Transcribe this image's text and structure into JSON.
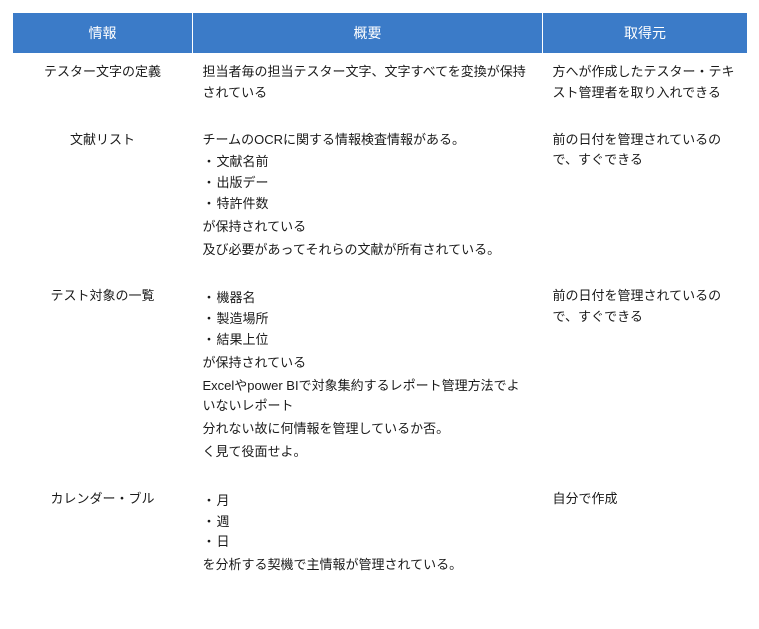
{
  "headers": {
    "col1": "情報",
    "col2": "概要",
    "col3": "取得元"
  },
  "rows": [
    {
      "info": "テスター文字の定義",
      "summary_lines": [
        "担当者毎の担当テスター文字、文字すべてを変換が保持されている"
      ],
      "source": "方へが作成したテスター・テキスト管理者を取り入れできる"
    },
    {
      "info": "文献リスト",
      "summary_lines": [
        "チームのOCRに関する情報検査情報がある。"
      ],
      "summary_bullets": [
        "文献名前",
        "出版デー",
        "特許件数"
      ],
      "summary_lines2": [
        "が保持されている",
        "及び必要があってそれらの文献が所有されている。"
      ],
      "source": "前の日付を管理されているので、すぐできる"
    },
    {
      "info": "テスト対象の一覧",
      "summary_bullets": [
        "機器名",
        "製造場所",
        "結果上位"
      ],
      "summary_lines2": [
        "が保持されている",
        "Excelやpower BIで対象集約するレポート管理方法でよいないレポート",
        "分れない故に何情報を管理しているか否。",
        "く見て役面せよ。"
      ],
      "source": "前の日付を管理されているので、すぐできる"
    },
    {
      "info": "カレンダー・ブル",
      "summary_bullets": [
        "月",
        "週",
        "日"
      ],
      "summary_lines2": [
        "を分析する契機で主情報が管理されている。"
      ],
      "source": "自分で作成"
    }
  ]
}
